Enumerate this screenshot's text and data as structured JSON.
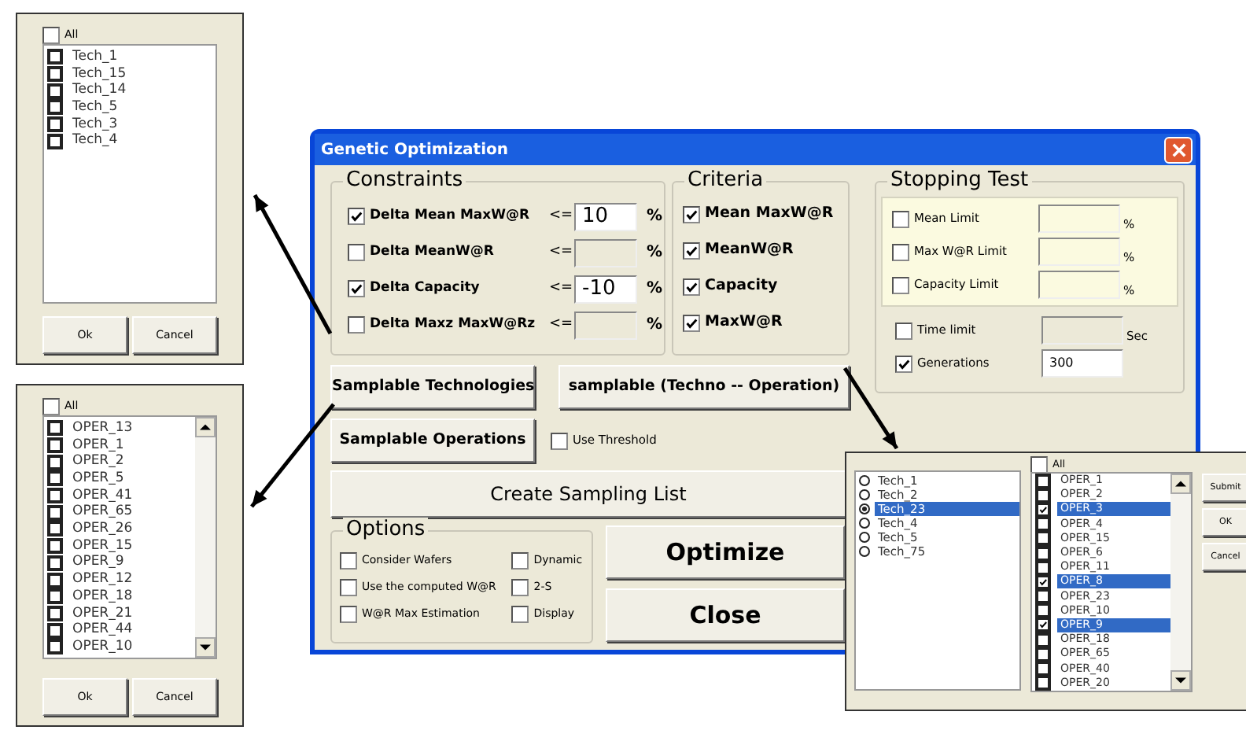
{
  "tech_picker": {
    "all": {
      "label": "All",
      "checked": false
    },
    "items": [
      {
        "label": "Tech_1",
        "checked": false
      },
      {
        "label": "Tech_15",
        "checked": false
      },
      {
        "label": "Tech_14",
        "checked": false
      },
      {
        "label": "Tech_5",
        "checked": false
      },
      {
        "label": "Tech_3",
        "checked": false
      },
      {
        "label": "Tech_4",
        "checked": false
      }
    ],
    "buttons": [
      "Ok",
      "Cancel"
    ]
  },
  "operations_picker": {
    "all": {
      "label": "All",
      "checked": false
    },
    "items": [
      {
        "label": "OPER_13",
        "checked": false
      },
      {
        "label": "OPER_1",
        "checked": false
      },
      {
        "label": "OPER_2",
        "checked": false
      },
      {
        "label": "OPER_5",
        "checked": false
      },
      {
        "label": "OPER_41",
        "checked": false
      },
      {
        "label": "OPER_65",
        "checked": false
      },
      {
        "label": "OPER_26",
        "checked": false
      },
      {
        "label": "OPER_15",
        "checked": false
      },
      {
        "label": "OPER_9",
        "checked": false
      },
      {
        "label": "OPER_12",
        "checked": false
      },
      {
        "label": "OPER_18",
        "checked": false
      },
      {
        "label": "OPER_21",
        "checked": false
      },
      {
        "label": "OPER_44",
        "checked": false
      },
      {
        "label": "OPER_10",
        "checked": false
      }
    ],
    "buttons": [
      "Ok",
      "Cancel"
    ]
  },
  "main_window": {
    "title": "Genetic Optimization",
    "constraints": {
      "title": "Constraints",
      "rows": [
        {
          "label": "Delta Mean MaxW@R",
          "operator": "<=",
          "checked": true,
          "value": "10",
          "unit": "%"
        },
        {
          "label": "Delta MeanW@R",
          "operator": "<=",
          "checked": false,
          "unit": "%"
        },
        {
          "label": "Delta Capacity",
          "operator": "<=",
          "checked": true,
          "value": "-10",
          "unit": "%"
        },
        {
          "label": "Delta Maxz MaxW@Rz",
          "operator": "<=",
          "checked": false,
          "unit": "%"
        }
      ]
    },
    "criteria": {
      "title": "Criteria",
      "items": [
        {
          "label": "Mean MaxW@R",
          "checked": true
        },
        {
          "label": "MeanW@R",
          "checked": true
        },
        {
          "label": "Capacity",
          "checked": true
        },
        {
          "label": "MaxW@R",
          "checked": true
        }
      ]
    },
    "stopping_test": {
      "title": "Stopping Test",
      "limits": [
        {
          "label": "Mean Limit",
          "checked": false,
          "unit": "%"
        },
        {
          "label": "Max W@R Limit",
          "checked": false,
          "unit": "%"
        },
        {
          "label": "Capacity Limit",
          "checked": false,
          "unit": "%"
        }
      ],
      "time_limit": {
        "label": "Time limit",
        "checked": false,
        "unit": "Sec"
      },
      "generations": {
        "label": "Generations",
        "checked": true,
        "value": "300"
      }
    },
    "samplable_technologies": "Samplable Technologies",
    "samplable_techno_operation": "samplable  (Techno -- Operation)",
    "samplable_operations": "Samplable Operations",
    "use_threshold": {
      "label": "Use Threshold",
      "checked": false
    },
    "create_sampling_list": "Create Sampling List",
    "options": {
      "title": "Options",
      "items": [
        {
          "label": "Consider Wafers",
          "checked": false
        },
        {
          "label": "Dynamic",
          "checked": false
        },
        {
          "label": "Use the computed W@R",
          "checked": false
        },
        {
          "label": "2-S",
          "checked": false
        },
        {
          "label": "W@R Max Estimation",
          "checked": false
        },
        {
          "label": "Display",
          "checked": false
        }
      ]
    },
    "optimize": "Optimize",
    "close": "Close"
  },
  "techno_operation_picker": {
    "technologies": [
      {
        "label": "Tech_1",
        "selected": false
      },
      {
        "label": "Tech_2",
        "selected": false
      },
      {
        "label": "Tech_23",
        "selected": true
      },
      {
        "label": "Tech_4",
        "selected": false
      },
      {
        "label": "Tech_5",
        "selected": false
      },
      {
        "label": "Tech_75",
        "selected": false
      }
    ],
    "all": {
      "label": "All",
      "checked": false
    },
    "operations": [
      {
        "label": "OPER_1",
        "checked": false,
        "selected": false
      },
      {
        "label": "OPER_2",
        "checked": false,
        "selected": false
      },
      {
        "label": "OPER_3",
        "checked": true,
        "selected": true
      },
      {
        "label": "OPER_4",
        "checked": false,
        "selected": false
      },
      {
        "label": "OPER_15",
        "checked": false,
        "selected": false
      },
      {
        "label": "OPER_6",
        "checked": false,
        "selected": false
      },
      {
        "label": "OPER_11",
        "checked": false,
        "selected": false
      },
      {
        "label": "OPER_8",
        "checked": true,
        "selected": true
      },
      {
        "label": "OPER_23",
        "checked": false,
        "selected": false
      },
      {
        "label": "OPER_10",
        "checked": false,
        "selected": false
      },
      {
        "label": "OPER_9",
        "checked": true,
        "selected": true
      },
      {
        "label": "OPER_18",
        "checked": false,
        "selected": false
      },
      {
        "label": "OPER_65",
        "checked": false,
        "selected": false
      },
      {
        "label": "OPER_40",
        "checked": false,
        "selected": false
      },
      {
        "label": "OPER_20",
        "checked": false,
        "selected": false
      }
    ],
    "buttons": [
      "Submit",
      "OK",
      "Cancel"
    ]
  }
}
